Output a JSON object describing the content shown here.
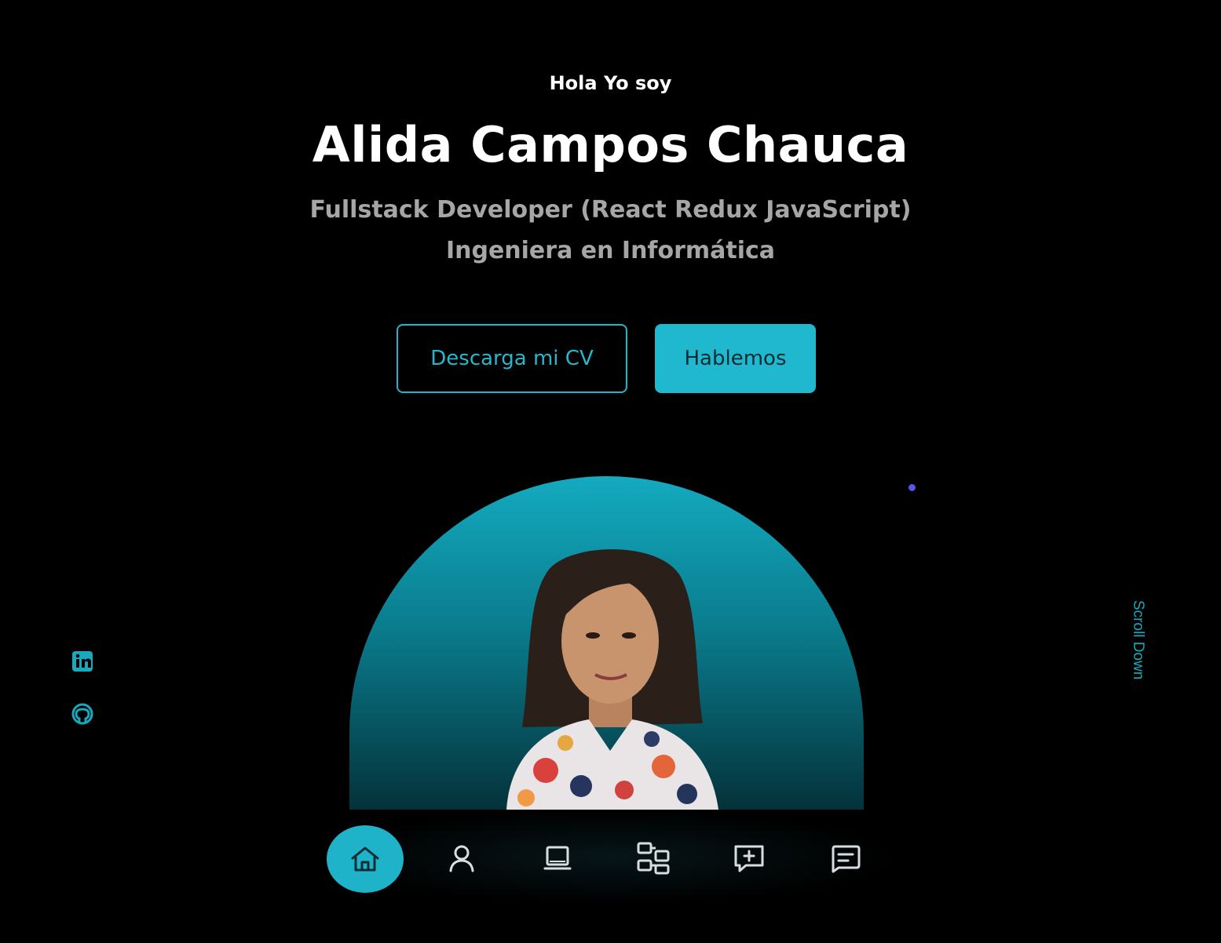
{
  "hero": {
    "greeting": "Hola Yo soy",
    "name": "Alida Campos Chauca",
    "role_line_1": "Fullstack Developer (React Redux JavaScript)",
    "role_line_2": "Ingeniera en Informática"
  },
  "buttons": {
    "download_cv": "Descarga mi CV",
    "contact": "Hablemos"
  },
  "scroll_down": "Scroll Down",
  "social": {
    "items": [
      "linkedin-icon",
      "github-icon"
    ]
  },
  "nav": {
    "items": [
      "home-icon",
      "user-icon",
      "laptop-icon",
      "services-icon",
      "chat-icon",
      "message-icon"
    ],
    "active": "home-icon"
  },
  "colors": {
    "background": "#000000",
    "accent": "#1fb8ce",
    "dot": "#5b54e6"
  }
}
